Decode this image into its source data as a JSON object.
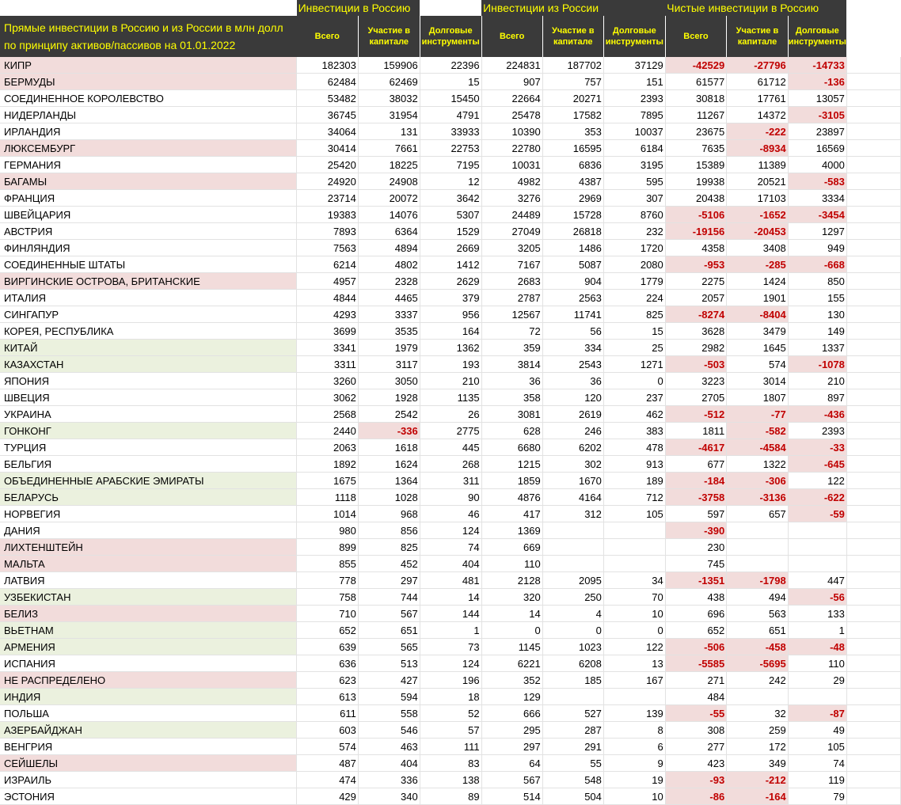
{
  "title": "Прямые инвестиции в Россию и из России в млн долл по принципу активов/пассивов на 01.01.2022",
  "groups": [
    "Инвестиции в Россию",
    "Инвестиции из России",
    "Чистые инвестиции в Россию"
  ],
  "columns": [
    "Всего",
    "Участие в капитале",
    "Долговые инструменты"
  ],
  "colors": {
    "header_bg": "#3a3a3a",
    "header_text": "#ffff00",
    "negative_text": "#c00000",
    "pink_fill": "#f2dcdb",
    "green_fill": "#ebf1de"
  },
  "rows": [
    {
      "name": "КИПР",
      "fill": "pink",
      "v": [
        "182303",
        "159906",
        "22396",
        "224831",
        "187702",
        "37129",
        "-42529",
        "-27796",
        "-14733"
      ]
    },
    {
      "name": "БЕРМУДЫ",
      "fill": "pink",
      "v": [
        "62484",
        "62469",
        "15",
        "907",
        "757",
        "151",
        "61577",
        "61712",
        "-136"
      ]
    },
    {
      "name": "СОЕДИНЕННОЕ КОРОЛЕВСТВО",
      "fill": "",
      "v": [
        "53482",
        "38032",
        "15450",
        "22664",
        "20271",
        "2393",
        "30818",
        "17761",
        "13057"
      ]
    },
    {
      "name": "НИДЕРЛАНДЫ",
      "fill": "",
      "v": [
        "36745",
        "31954",
        "4791",
        "25478",
        "17582",
        "7895",
        "11267",
        "14372",
        "-3105"
      ]
    },
    {
      "name": "ИРЛАНДИЯ",
      "fill": "",
      "v": [
        "34064",
        "131",
        "33933",
        "10390",
        "353",
        "10037",
        "23675",
        "-222",
        "23897"
      ]
    },
    {
      "name": "ЛЮКСЕМБУРГ",
      "fill": "pink",
      "v": [
        "30414",
        "7661",
        "22753",
        "22780",
        "16595",
        "6184",
        "7635",
        "-8934",
        "16569"
      ]
    },
    {
      "name": "ГЕРМАНИЯ",
      "fill": "",
      "v": [
        "25420",
        "18225",
        "7195",
        "10031",
        "6836",
        "3195",
        "15389",
        "11389",
        "4000"
      ]
    },
    {
      "name": "БАГАМЫ",
      "fill": "pink",
      "v": [
        "24920",
        "24908",
        "12",
        "4982",
        "4387",
        "595",
        "19938",
        "20521",
        "-583"
      ]
    },
    {
      "name": "ФРАНЦИЯ",
      "fill": "",
      "v": [
        "23714",
        "20072",
        "3642",
        "3276",
        "2969",
        "307",
        "20438",
        "17103",
        "3334"
      ]
    },
    {
      "name": "ШВЕЙЦАРИЯ",
      "fill": "",
      "v": [
        "19383",
        "14076",
        "5307",
        "24489",
        "15728",
        "8760",
        "-5106",
        "-1652",
        "-3454"
      ]
    },
    {
      "name": "АВСТРИЯ",
      "fill": "",
      "v": [
        "7893",
        "6364",
        "1529",
        "27049",
        "26818",
        "232",
        "-19156",
        "-20453",
        "1297"
      ]
    },
    {
      "name": "ФИНЛЯНДИЯ",
      "fill": "",
      "v": [
        "7563",
        "4894",
        "2669",
        "3205",
        "1486",
        "1720",
        "4358",
        "3408",
        "949"
      ]
    },
    {
      "name": "СОЕДИНЕННЫЕ ШТАТЫ",
      "fill": "",
      "v": [
        "6214",
        "4802",
        "1412",
        "7167",
        "5087",
        "2080",
        "-953",
        "-285",
        "-668"
      ]
    },
    {
      "name": "ВИРГИНСКИЕ ОСТРОВА, БРИТАНСКИЕ",
      "fill": "pink",
      "v": [
        "4957",
        "2328",
        "2629",
        "2683",
        "904",
        "1779",
        "2275",
        "1424",
        "850"
      ]
    },
    {
      "name": "ИТАЛИЯ",
      "fill": "",
      "v": [
        "4844",
        "4465",
        "379",
        "2787",
        "2563",
        "224",
        "2057",
        "1901",
        "155"
      ]
    },
    {
      "name": "СИНГАПУР",
      "fill": "",
      "v": [
        "4293",
        "3337",
        "956",
        "12567",
        "11741",
        "825",
        "-8274",
        "-8404",
        "130"
      ]
    },
    {
      "name": "КОРЕЯ, РЕСПУБЛИКА",
      "fill": "",
      "v": [
        "3699",
        "3535",
        "164",
        "72",
        "56",
        "15",
        "3628",
        "3479",
        "149"
      ]
    },
    {
      "name": "КИТАЙ",
      "fill": "green",
      "v": [
        "3341",
        "1979",
        "1362",
        "359",
        "334",
        "25",
        "2982",
        "1645",
        "1337"
      ]
    },
    {
      "name": "КАЗАХСТАН",
      "fill": "green",
      "v": [
        "3311",
        "3117",
        "193",
        "3814",
        "2543",
        "1271",
        "-503",
        "574",
        "-1078"
      ]
    },
    {
      "name": "ЯПОНИЯ",
      "fill": "",
      "v": [
        "3260",
        "3050",
        "210",
        "36",
        "36",
        "0",
        "3223",
        "3014",
        "210"
      ]
    },
    {
      "name": "ШВЕЦИЯ",
      "fill": "",
      "v": [
        "3062",
        "1928",
        "1135",
        "358",
        "120",
        "237",
        "2705",
        "1807",
        "897"
      ]
    },
    {
      "name": "УКРАИНА",
      "fill": "",
      "v": [
        "2568",
        "2542",
        "26",
        "3081",
        "2619",
        "462",
        "-512",
        "-77",
        "-436"
      ]
    },
    {
      "name": "ГОНКОНГ",
      "fill": "green",
      "v": [
        "2440",
        "-336",
        "2775",
        "628",
        "246",
        "383",
        "1811",
        "-582",
        "2393"
      ]
    },
    {
      "name": "ТУРЦИЯ",
      "fill": "",
      "v": [
        "2063",
        "1618",
        "445",
        "6680",
        "6202",
        "478",
        "-4617",
        "-4584",
        "-33"
      ]
    },
    {
      "name": "БЕЛЬГИЯ",
      "fill": "",
      "v": [
        "1892",
        "1624",
        "268",
        "1215",
        "302",
        "913",
        "677",
        "1322",
        "-645"
      ]
    },
    {
      "name": "ОБЪЕДИНЕННЫЕ АРАБСКИЕ ЭМИРАТЫ",
      "fill": "green",
      "v": [
        "1675",
        "1364",
        "311",
        "1859",
        "1670",
        "189",
        "-184",
        "-306",
        "122"
      ]
    },
    {
      "name": "БЕЛАРУСЬ",
      "fill": "green",
      "v": [
        "1118",
        "1028",
        "90",
        "4876",
        "4164",
        "712",
        "-3758",
        "-3136",
        "-622"
      ]
    },
    {
      "name": "НОРВЕГИЯ",
      "fill": "",
      "v": [
        "1014",
        "968",
        "46",
        "417",
        "312",
        "105",
        "597",
        "657",
        "-59"
      ]
    },
    {
      "name": "ДАНИЯ",
      "fill": "",
      "v": [
        "980",
        "856",
        "124",
        "1369",
        "",
        "",
        "-390",
        "",
        ""
      ]
    },
    {
      "name": "ЛИХТЕНШТЕЙН",
      "fill": "pink",
      "v": [
        "899",
        "825",
        "74",
        "669",
        "",
        "",
        "230",
        "",
        ""
      ]
    },
    {
      "name": "МАЛЬТА",
      "fill": "pink",
      "v": [
        "855",
        "452",
        "404",
        "110",
        "",
        "",
        "745",
        "",
        ""
      ]
    },
    {
      "name": "ЛАТВИЯ",
      "fill": "",
      "v": [
        "778",
        "297",
        "481",
        "2128",
        "2095",
        "34",
        "-1351",
        "-1798",
        "447"
      ]
    },
    {
      "name": "УЗБЕКИСТАН",
      "fill": "green",
      "v": [
        "758",
        "744",
        "14",
        "320",
        "250",
        "70",
        "438",
        "494",
        "-56"
      ]
    },
    {
      "name": "БЕЛИЗ",
      "fill": "pink",
      "v": [
        "710",
        "567",
        "144",
        "14",
        "4",
        "10",
        "696",
        "563",
        "133"
      ]
    },
    {
      "name": "ВЬЕТНАМ",
      "fill": "green",
      "v": [
        "652",
        "651",
        "1",
        "0",
        "0",
        "0",
        "652",
        "651",
        "1"
      ]
    },
    {
      "name": "АРМЕНИЯ",
      "fill": "green",
      "v": [
        "639",
        "565",
        "73",
        "1145",
        "1023",
        "122",
        "-506",
        "-458",
        "-48"
      ]
    },
    {
      "name": "ИСПАНИЯ",
      "fill": "",
      "v": [
        "636",
        "513",
        "124",
        "6221",
        "6208",
        "13",
        "-5585",
        "-5695",
        "110"
      ]
    },
    {
      "name": "НЕ РАСПРЕДЕЛЕНО",
      "fill": "pink",
      "v": [
        "623",
        "427",
        "196",
        "352",
        "185",
        "167",
        "271",
        "242",
        "29"
      ]
    },
    {
      "name": "ИНДИЯ",
      "fill": "green",
      "v": [
        "613",
        "594",
        "18",
        "129",
        "",
        "",
        "484",
        "",
        ""
      ]
    },
    {
      "name": "ПОЛЬША",
      "fill": "",
      "v": [
        "611",
        "558",
        "52",
        "666",
        "527",
        "139",
        "-55",
        "32",
        "-87"
      ]
    },
    {
      "name": "АЗЕРБАЙДЖАН",
      "fill": "green",
      "v": [
        "603",
        "546",
        "57",
        "295",
        "287",
        "8",
        "308",
        "259",
        "49"
      ]
    },
    {
      "name": "ВЕНГРИЯ",
      "fill": "",
      "v": [
        "574",
        "463",
        "111",
        "297",
        "291",
        "6",
        "277",
        "172",
        "105"
      ]
    },
    {
      "name": "СЕЙШЕЛЫ",
      "fill": "pink",
      "v": [
        "487",
        "404",
        "83",
        "64",
        "55",
        "9",
        "423",
        "349",
        "74"
      ]
    },
    {
      "name": "ИЗРАИЛЬ",
      "fill": "",
      "v": [
        "474",
        "336",
        "138",
        "567",
        "548",
        "19",
        "-93",
        "-212",
        "119"
      ]
    },
    {
      "name": "ЭСТОНИЯ",
      "fill": "",
      "v": [
        "429",
        "340",
        "89",
        "514",
        "504",
        "10",
        "-86",
        "-164",
        "79"
      ]
    }
  ]
}
